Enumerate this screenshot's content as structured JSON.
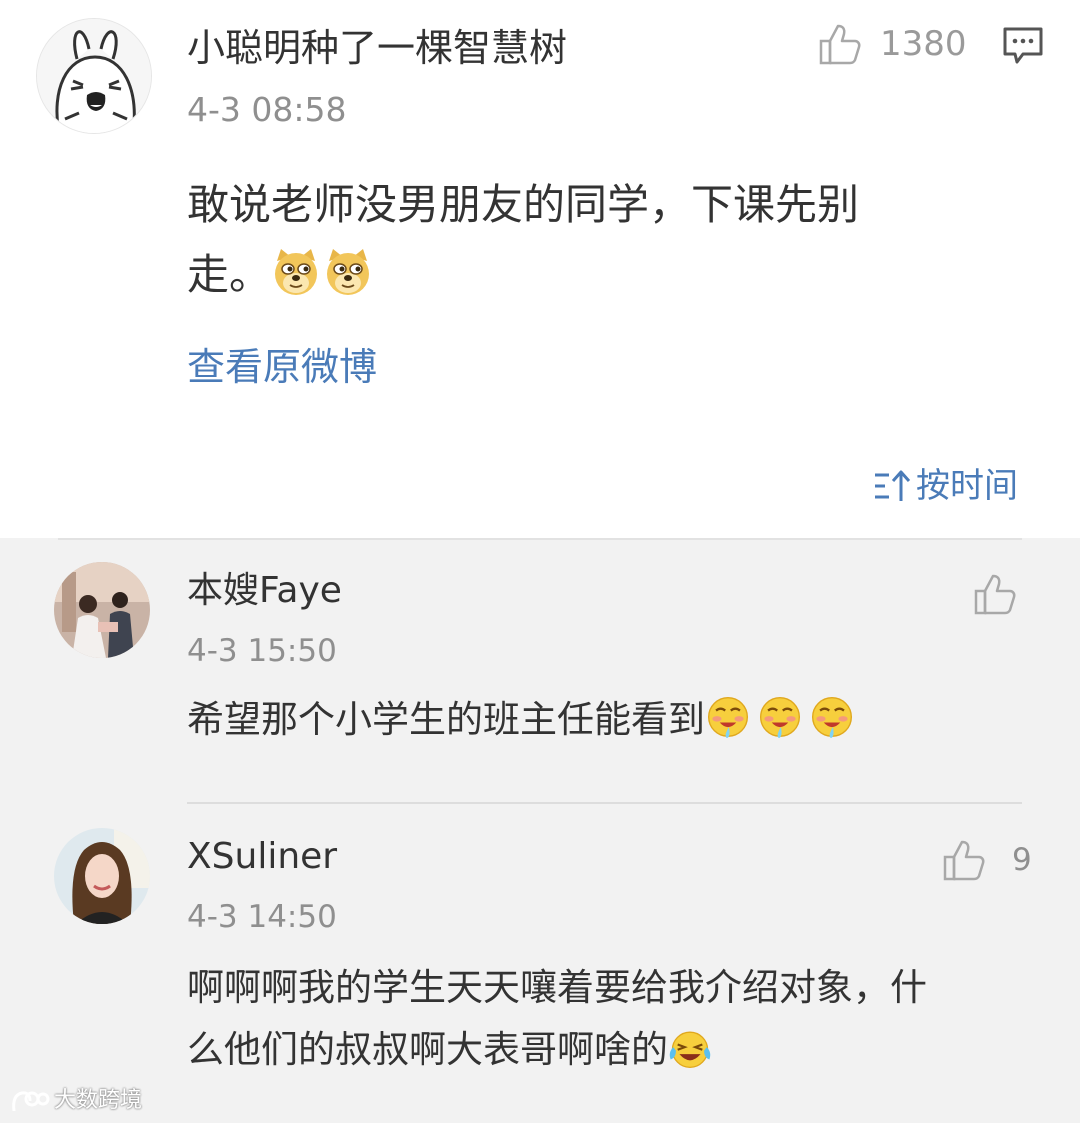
{
  "main_post": {
    "username": "小聪明种了一棵智慧树",
    "time": "4-3 08:58",
    "like_count": "1380",
    "content_line1": "敢说老师没男朋友的同学，下课先别",
    "content_line2": "走。",
    "emoji_names": [
      "doge-emoji",
      "doge-emoji"
    ],
    "view_original": "查看原微博",
    "sort_label": "按时间"
  },
  "comments": [
    {
      "username": "本嫂Faye",
      "time": "4-3 15:50",
      "text": "希望那个小学生的班主任能看到",
      "emoji_names": [
        "drool-emoji",
        "drool-emoji",
        "drool-emoji"
      ],
      "like_count": ""
    },
    {
      "username": "XSuliner",
      "time": "4-3 14:50",
      "text_line1": "啊啊啊我的学生天天嚷着要给我介绍对象，什",
      "text_line2": "么他们的叔叔啊大表哥啊啥的",
      "emoji_names": [
        "laugh-cry-emoji"
      ],
      "like_count": "9"
    }
  ],
  "watermark": "大数跨境",
  "colors": {
    "link_blue": "#4a7bb8",
    "list_background": "#f2f2f2",
    "text": "#333333",
    "meta_gray": "#8f8f8f"
  }
}
